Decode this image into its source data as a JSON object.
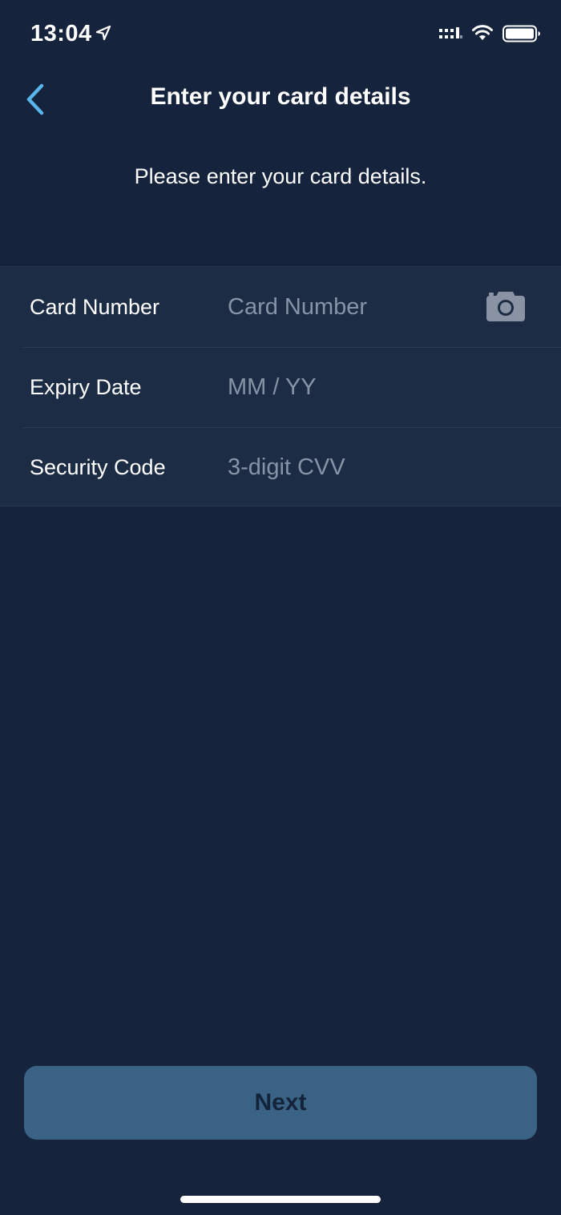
{
  "status_bar": {
    "time": "13:04",
    "icons": [
      "location-arrow-icon",
      "cellular-signal-icon",
      "wifi-icon",
      "battery-icon"
    ]
  },
  "nav": {
    "back_icon": "chevron-left-icon",
    "title": "Enter your card details"
  },
  "subtitle": "Please enter your card details.",
  "form": {
    "card_number": {
      "label": "Card Number",
      "placeholder": "Card Number",
      "value": "",
      "action_icon": "camera-icon"
    },
    "expiry_date": {
      "label": "Expiry Date",
      "placeholder": "MM / YY",
      "value": ""
    },
    "security_code": {
      "label": "Security Code",
      "placeholder": "3-digit CVV",
      "value": ""
    }
  },
  "next_button": {
    "label": "Next",
    "enabled": false
  },
  "colors": {
    "background": "#15233c",
    "form_background": "#1d2c45",
    "accent": "#5ab4ea",
    "button_disabled": "#3a6284",
    "placeholder": "#8793a6"
  }
}
